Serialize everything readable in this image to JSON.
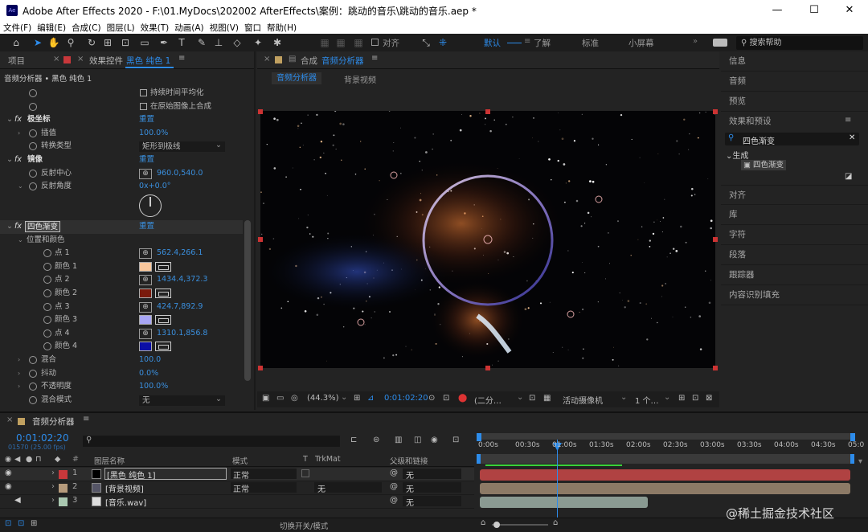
{
  "window": {
    "title": "Adobe After Effects 2020 - F:\\01.MyDocs\\202002 AfterEffects\\案例：跳动的音乐\\跳动的音乐.aep *",
    "app_icon": "Ae"
  },
  "menu": [
    "文件(F)",
    "编辑(E)",
    "合成(C)",
    "图层(L)",
    "效果(T)",
    "动画(A)",
    "视图(V)",
    "窗口",
    "帮助(H)"
  ],
  "toolbar": {
    "align_label": "对齐",
    "workspaces": [
      "默认",
      "了解",
      "标准",
      "小屏幕"
    ],
    "active_workspace": "默认",
    "search_help": "搜索帮助"
  },
  "left_panel": {
    "tab_project": "项目",
    "tab_effects": "效果控件",
    "tab_effects_layer": "黑色 纯色 1",
    "breadcrumb": "音频分析器 • 黑色 纯色 1",
    "checkbox_1": "持续时间平均化",
    "checkbox_2": "在原始图像上合成",
    "fx1": {
      "name": "极坐标",
      "reset": "重置",
      "interp_label": "插值",
      "interp_value": "100.0%",
      "conv_label": "转换类型",
      "conv_value": "矩形到极线"
    },
    "fx2": {
      "name": "镜像",
      "reset": "重置",
      "center_label": "反射中心",
      "center_value": "960.0,540.0",
      "angle_label": "反射角度",
      "angle_value": "0x+0.0°"
    },
    "fx3": {
      "name": "四色渐变",
      "reset": "重置",
      "group_label": "位置和颜色",
      "rows": [
        {
          "label": "点 1",
          "value": "562.4,266.1"
        },
        {
          "label": "颜色 1",
          "color": "#f9c79c"
        },
        {
          "label": "点 2",
          "value": "1434.4,372.3"
        },
        {
          "label": "颜色 2",
          "color": "#7a1a0c"
        },
        {
          "label": "点 3",
          "value": "424.7,892.9"
        },
        {
          "label": "颜色 3",
          "color": "#a8a6f5"
        },
        {
          "label": "点 4",
          "value": "1310.1,856.8"
        },
        {
          "label": "颜色 4",
          "color": "#0b0fa6"
        }
      ],
      "blend_label": "混合",
      "blend_value": "100.0",
      "jitter_label": "抖动",
      "jitter_value": "0.0%",
      "opacity_label": "不透明度",
      "opacity_value": "100.0%",
      "mode_label": "混合模式",
      "mode_value": "无"
    }
  },
  "comp_panel": {
    "tab": "合成",
    "tab_name": "音频分析器",
    "subtabs": [
      "音频分析器",
      "背景视频"
    ],
    "zoom": "(44.3%)",
    "timecode": "0:01:02:20",
    "resolution": "(二分…",
    "camera": "活动摄像机",
    "views": "1 个…"
  },
  "right_panel": {
    "items_top": [
      "信息",
      "音频",
      "预览",
      "效果和预设"
    ],
    "search_value": "四色渐变",
    "tree_group": "生成",
    "tree_item": "四色渐变",
    "items_bottom": [
      "对齐",
      "库",
      "字符",
      "段落",
      "跟踪器",
      "内容识别填充"
    ]
  },
  "timeline": {
    "tab": "音频分析器",
    "timecode": "0:01:02:20",
    "frame_info": "01570 (25.00 fps)",
    "headers": {
      "name": "图层名称",
      "mode": "模式",
      "t": "T",
      "trkmat": "TrkMat",
      "parent": "父级和链接"
    },
    "layers": [
      {
        "num": "1",
        "name": "[黑色 纯色 1]",
        "mode": "正常",
        "trkmat": "",
        "parent": "无",
        "label_color": "#c8383b"
      },
      {
        "num": "2",
        "name": "[背景视频]",
        "mode": "正常",
        "trkmat": "无",
        "parent": "无",
        "label_color": "#b69b7c"
      },
      {
        "num": "3",
        "name": "[音乐.wav]",
        "mode": "",
        "trkmat": "",
        "parent": "无",
        "label_color": "#a9c7b0"
      }
    ],
    "ruler": [
      "0:00s",
      "00:30s",
      "01:00s",
      "01:30s",
      "02:00s",
      "02:30s",
      "03:00s",
      "03:30s",
      "04:00s",
      "04:30s",
      "05:0"
    ],
    "footer": "切换开关/模式",
    "watermark": "@稀土掘金技术社区"
  }
}
